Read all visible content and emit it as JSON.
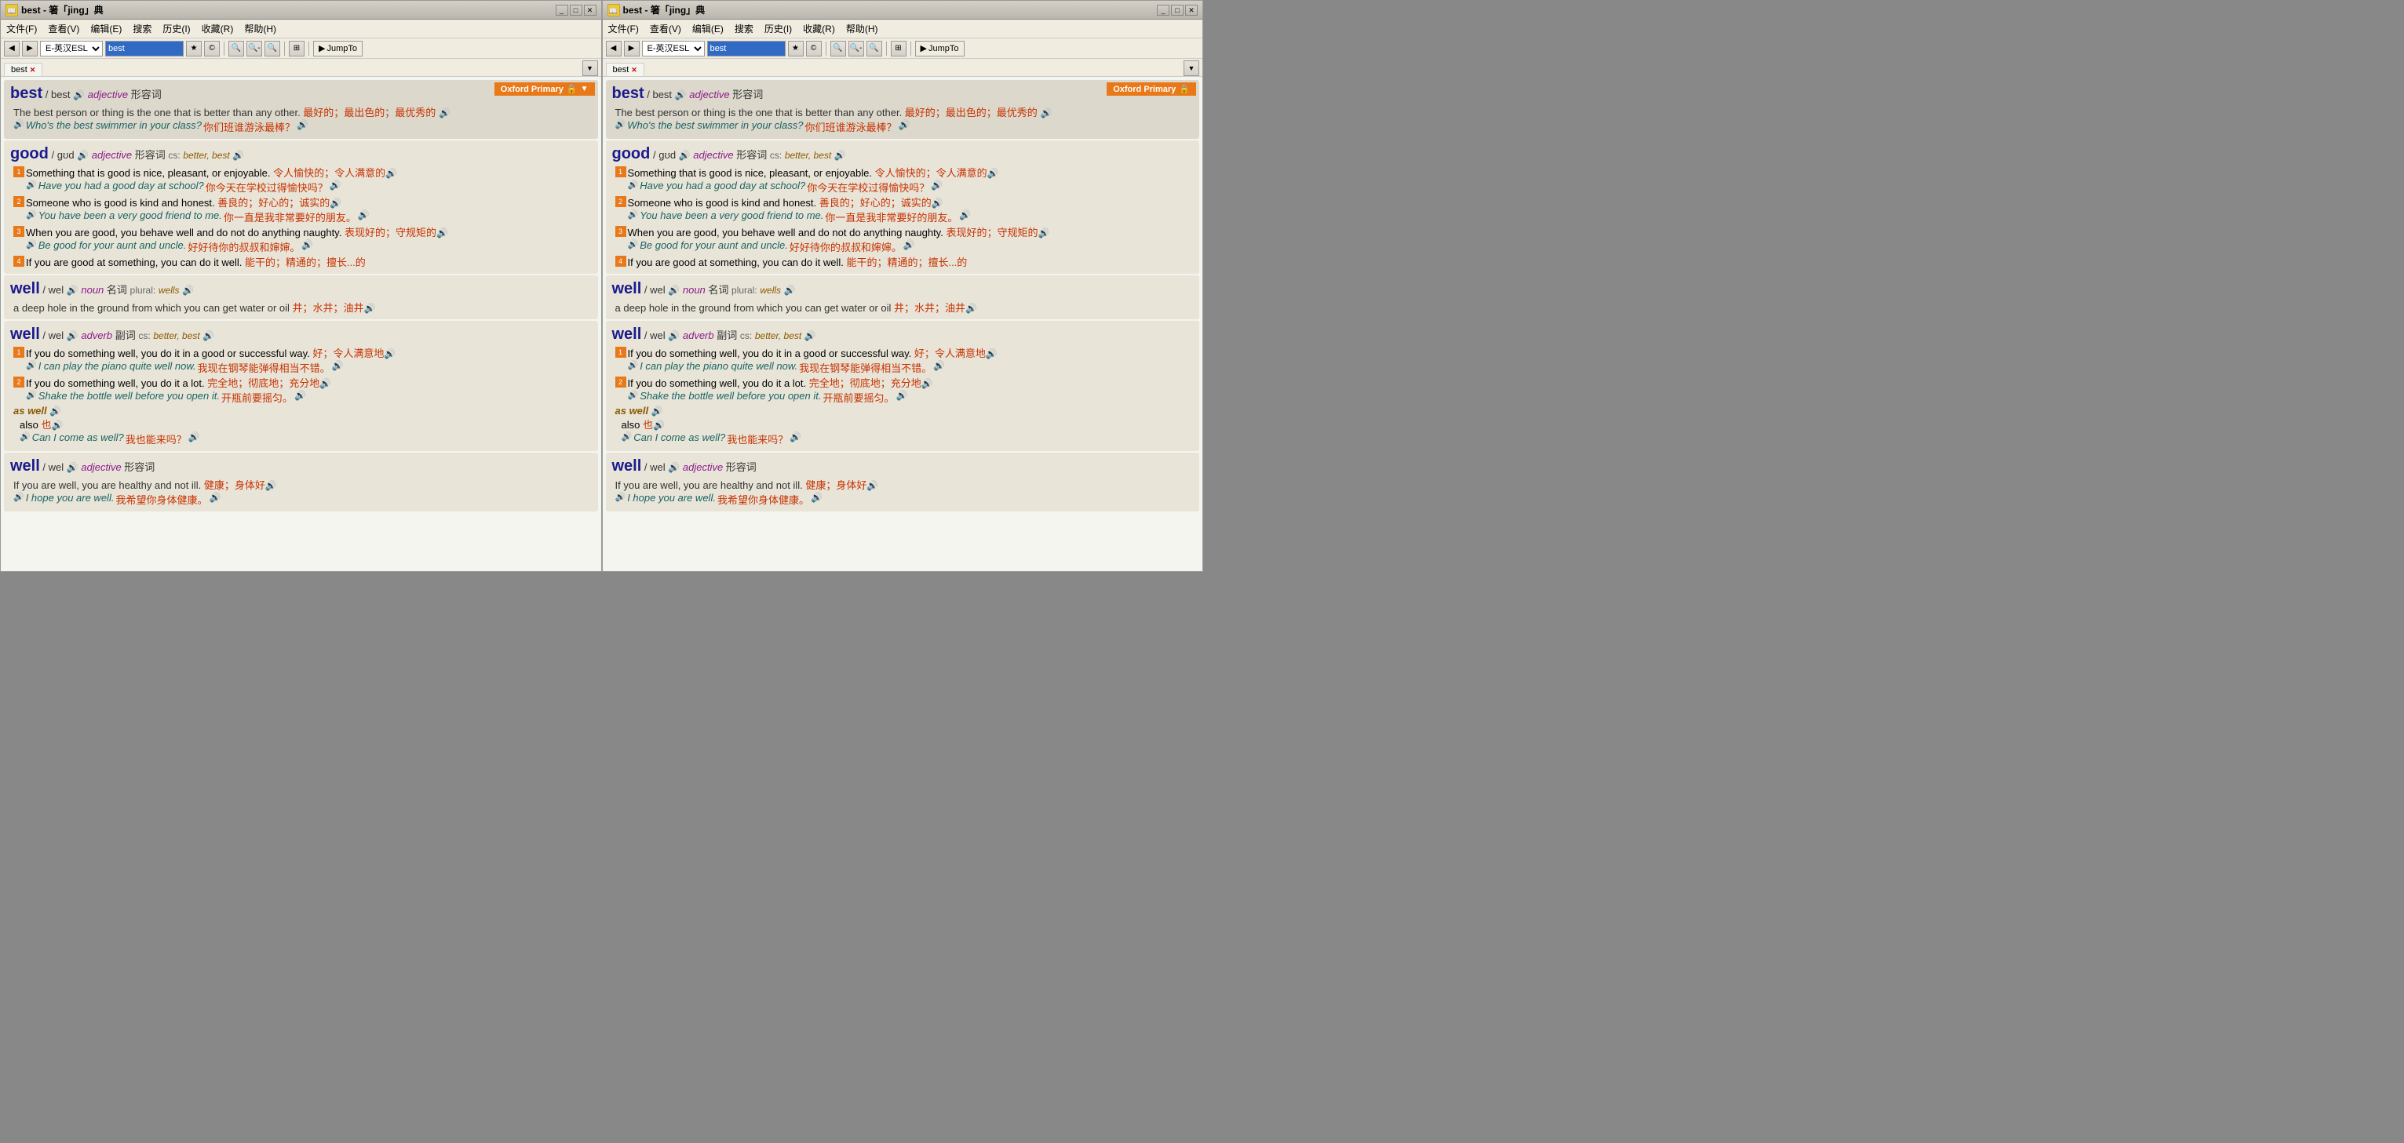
{
  "app": {
    "title": "best - 箸「jing」典",
    "icon": "📖"
  },
  "menus": {
    "file": "文件(F)",
    "view": "查看(V)",
    "edit": "编辑(E)",
    "search": "搜索",
    "history": "历史(I)",
    "bookmark": "收藏(R)",
    "help": "帮助(H)"
  },
  "toolbar": {
    "dict_select": "E-英汉ESL",
    "search_value": "best",
    "jumpTo_label": "JumpTo"
  },
  "tabs": {
    "active": "best"
  },
  "oxford_badge": "Oxford Primary",
  "entries": [
    {
      "id": "best-adj",
      "headword": "best",
      "pronunciation": "/ best",
      "audio": true,
      "pos": "adjective",
      "pos_label": "形容词",
      "definition": "The best person or thing is the one that is better than any other.",
      "chinese_def": "最好的；最出色的；最优秀的",
      "examples": [
        {
          "audio": true,
          "en": "Who's the best swimmer in your class?",
          "zh": "你们班谁游泳最棒？"
        }
      ]
    },
    {
      "id": "good-adj",
      "headword": "good",
      "pronunciation": "/ gʊd",
      "audio": true,
      "pos": "adjective",
      "pos_label": "形容词",
      "cs_label": "cs:",
      "cs_forms": "better, best",
      "definitions": [
        {
          "num": "1",
          "type": "orange",
          "text": "Something that is good is nice, pleasant, or enjoyable.",
          "zh": "令人愉快的；令人满意的",
          "example_en": "Have you had a good day at school?",
          "example_zh": "你今天在学校过得愉快吗？"
        },
        {
          "num": "2",
          "type": "orange",
          "text": "Someone who is good is kind and honest.",
          "zh": "善良的；好心的；诚实的",
          "example_en": "You have been a very good friend to me.",
          "example_zh": "你一直是我非常要好的朋友。"
        },
        {
          "num": "3",
          "type": "orange",
          "text": "When you are good, you behave well and do not do anything naughty.",
          "zh": "表现好的；守规矩的",
          "example_en": "Be good for your aunt and uncle.",
          "example_zh": "好好待你的叔叔和婶婶。"
        },
        {
          "num": "4",
          "type": "orange",
          "text": "If you are good at something, you can do it well.",
          "zh": "能干的；精通的；擅长...的"
        }
      ]
    },
    {
      "id": "well-noun",
      "headword": "well",
      "pronunciation": "/ wel",
      "audio": true,
      "pos": "noun",
      "pos_label": "名词",
      "plural_label": "plural:",
      "plural": "wells",
      "definition": "a deep hole in the ground from which you can get water or oil",
      "chinese_def": "井；水井；油井"
    },
    {
      "id": "well-adv",
      "headword": "well",
      "pronunciation": "/ wel",
      "audio": true,
      "pos": "adverb",
      "pos_label": "副词",
      "cs_label": "cs:",
      "cs_forms": "better, best",
      "definitions": [
        {
          "num": "1",
          "type": "orange",
          "text": "If you do something well, you do it in a good or successful way.",
          "zh": "好；令人满意地",
          "example_en": "I can play the piano quite well now.",
          "example_zh": "我现在钢琴能弹得相当不错。"
        },
        {
          "num": "2",
          "type": "orange",
          "text": "If you do something well, you do it a lot.",
          "zh": "完全地；彻底地；充分地",
          "example_en": "Shake the bottle well before you open it.",
          "example_zh": "开瓶前要摇匀。"
        }
      ],
      "phrase": {
        "label": "as well",
        "sub_label": "also",
        "zh": "也",
        "example_en": "Can I come as well?",
        "example_zh": "我也能来吗？"
      }
    },
    {
      "id": "well-adj",
      "headword": "well",
      "pronunciation": "/ wel",
      "audio": true,
      "pos": "adjective",
      "pos_label": "形容词",
      "definition": "If you are well, you are healthy and not ill.",
      "chinese_def": "健康；身体好",
      "examples": [
        {
          "audio": true,
          "en": "I hope you are well.",
          "zh": "我希望你身体健康。"
        }
      ]
    }
  ]
}
